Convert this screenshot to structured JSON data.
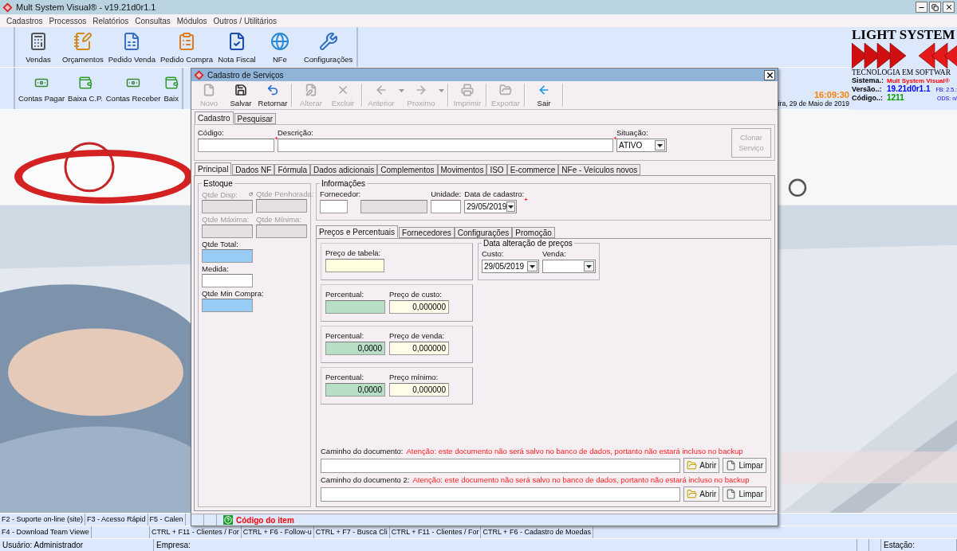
{
  "main_window": {
    "title": "Mult System Visual®  - v19.21d0r1.1"
  },
  "menu": [
    "Cadastros",
    "Processos",
    "Relatórios",
    "Consultas",
    "Módulos",
    "Outros / Utilitários"
  ],
  "toolbar_1": [
    {
      "label": "Vendas",
      "kind": "register"
    },
    {
      "label": "Orçamentos",
      "kind": "quote"
    },
    {
      "label": "Pedido Venda",
      "kind": "sales-order"
    },
    {
      "label": "Pedido Compra",
      "kind": "purchase-order"
    },
    {
      "label": "Nota Fiscal",
      "kind": "invoice"
    },
    {
      "label": "NFe",
      "kind": "nfe"
    },
    {
      "label": "Configurações",
      "kind": "settings"
    }
  ],
  "toolbar_2": [
    {
      "label": "Contas Pagar",
      "kind": "pay"
    },
    {
      "label": "Baixa C.P.",
      "kind": "settle"
    },
    {
      "label": "Contas Receber",
      "kind": "receive"
    },
    {
      "label": "Baix",
      "kind": "settle"
    }
  ],
  "clock": "16:09:30",
  "date": "ira, 29 de Maio de 2019",
  "brand": {
    "name": "LIGHT SYSTEM",
    "tagline": "TECNOLOGIA EM SOFTWAR",
    "info": [
      {
        "label": "Sistema.:",
        "value": "Mult System Visual®",
        "color": "#ff0000"
      },
      {
        "label": "Versão..:",
        "value": "19.21d0r1.1",
        "color": "#0000ff",
        "note": "FB: 2.5.:"
      },
      {
        "label": "Código..:",
        "value": "1211",
        "color": "#009900",
        "note": "ODS: n/"
      }
    ]
  },
  "dialog": {
    "title": "Cadastro de Serviços",
    "toolbar": [
      {
        "label": "Novo",
        "kind": "new",
        "disabled": true,
        "dropdown": false
      },
      {
        "label": "Salvar",
        "kind": "save",
        "disabled": false,
        "dropdown": false
      },
      {
        "label": "Retornar",
        "kind": "undo",
        "disabled": false,
        "dropdown": false
      },
      {
        "label": "Alterar",
        "kind": "edit",
        "disabled": true,
        "dropdown": false
      },
      {
        "label": "Excluir",
        "kind": "delete",
        "disabled": true,
        "dropdown": false
      },
      {
        "label": "Anterior",
        "kind": "previous",
        "disabled": true,
        "dropdown": true
      },
      {
        "label": "Proximo",
        "kind": "next",
        "disabled": true,
        "dropdown": true
      },
      {
        "label": "Imprimir",
        "kind": "print",
        "disabled": true,
        "dropdown": false
      },
      {
        "label": "Exportar",
        "kind": "export",
        "disabled": true,
        "dropdown": false
      },
      {
        "label": "Sair",
        "kind": "exit",
        "disabled": false,
        "dropdown": false
      }
    ],
    "tabs": [
      {
        "label": "Cadastro",
        "selected": true
      },
      {
        "label": "Pesquisar",
        "selected": false
      }
    ],
    "code": {
      "label": "Código:",
      "required": true
    },
    "description": {
      "label": "Descrição:",
      "required": true
    },
    "status": {
      "label": "Situação:",
      "value": "ATIVO"
    },
    "clone_button": {
      "label": "Clonar Serviço",
      "disabled": true
    },
    "section_tabs": [
      {
        "label": "Principal",
        "selected": true
      },
      {
        "label": "Dados NF",
        "selected": false
      },
      {
        "label": "Fórmula",
        "selected": false
      },
      {
        "label": "Dados adicionais",
        "selected": false
      },
      {
        "label": "Complementos",
        "selected": false
      },
      {
        "label": "Movimentos",
        "selected": false
      },
      {
        "label": "ISO",
        "selected": false
      },
      {
        "label": "E-commerce",
        "selected": false
      },
      {
        "label": "NFe - Veículos novos",
        "selected": false
      }
    ],
    "stock": {
      "title": "Estoque",
      "fields": [
        {
          "label": "Qtde Disp:",
          "kind": "readonly"
        },
        {
          "label": "Qtde Penhorada:",
          "kind": "readonly"
        },
        {
          "label": "Qtde Máxima:",
          "kind": "readonly"
        },
        {
          "label": "Qtde Mínima:",
          "kind": "readonly"
        },
        {
          "label": "Qtde Total:",
          "kind": "total"
        },
        {
          "label": "Medida:",
          "kind": "input"
        },
        {
          "label": "Qtde Min Compra:",
          "kind": "total"
        }
      ]
    },
    "info": {
      "title": "Informações",
      "supplier_label": "Fornecedor:",
      "unit_label": "Unidade:",
      "date": {
        "label": "Data de cadastro:",
        "value": "29/05/2019",
        "required": true
      }
    },
    "price_tabs": [
      {
        "label": "Preços e Percentuais",
        "selected": true
      },
      {
        "label": "Fornecedores",
        "selected": false
      },
      {
        "label": "Configurações",
        "selected": false
      },
      {
        "label": "Promoção",
        "selected": false
      }
    ],
    "table_price": {
      "label": "Preço de tabela:"
    },
    "price_rows": [
      {
        "percent_label": "Percentual:",
        "price_label": "Preço de custo:",
        "price": "0,000000"
      },
      {
        "percent_label": "Percentual:",
        "percent": "0,0000",
        "price_label": "Preço de venda:",
        "price": "0,000000"
      },
      {
        "percent_label": "Percentual:",
        "percent": "0,0000",
        "price_label": "Preço mínimo:",
        "price": "0,000000"
      }
    ],
    "price_dates": {
      "title": "Data alteração de preços",
      "cost_label": "Custo:",
      "cost": "29/05/2019",
      "sale_label": "Venda:"
    },
    "documents": [
      {
        "label": "Caminho do documento:",
        "warning": "Atenção: este documento não será salvo no banco de dados, portanto não estará incluso no backup",
        "open_button": "Abrir",
        "clear_button": "Limpar"
      },
      {
        "label": "Caminho do documento 2:",
        "warning": "Atenção: este documento não será salvo no banco de dados, portanto não estará incluso no backup",
        "open_button": "Abrir",
        "clear_button": "Limpar"
      }
    ],
    "status_text": "Código do item"
  },
  "footer_rows": [
    [
      "F2 - Suporte on-line (site)",
      "F3 - Acesso Rápid",
      "F5 - Calen"
    ],
    [
      "F4 - Download Team Viewe",
      "CTRL + F11 - Clientes / For",
      "CTRL + F6 - Follow-u",
      "CTRL + F7 - Busca Cli",
      "CTRL + F11 - Clientes / For",
      "CTRL + F6 - Cadastro de Moedas"
    ]
  ],
  "status_bar": [
    "Usuário: Administrador",
    "Empresa:",
    "Estação:"
  ]
}
